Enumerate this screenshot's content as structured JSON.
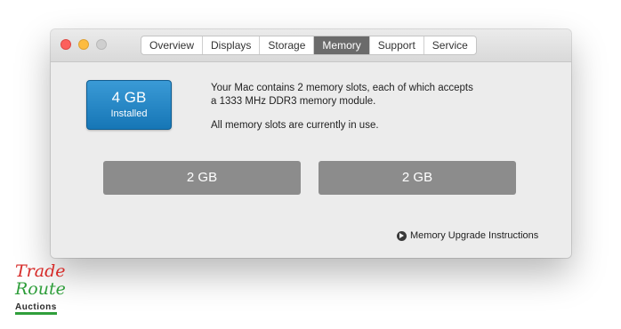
{
  "tabs": [
    {
      "label": "Overview"
    },
    {
      "label": "Displays"
    },
    {
      "label": "Storage"
    },
    {
      "label": "Memory",
      "active": true
    },
    {
      "label": "Support"
    },
    {
      "label": "Service"
    }
  ],
  "memory": {
    "amount": "4 GB",
    "status": "Installed",
    "description_line1": "Your Mac contains 2 memory slots, each of which accepts",
    "description_line2": "a 1333 MHz DDR3 memory module.",
    "slots_status": "All memory slots are currently in use.",
    "slots": [
      "2 GB",
      "2 GB"
    ],
    "upgrade_link": "Memory Upgrade Instructions"
  },
  "watermark": {
    "line1": "Trade",
    "line2": "Route",
    "line3": "Auctions"
  },
  "colors": {
    "badge": "#1f86c6",
    "slot": "#8c8c8c",
    "active_tab": "#6b6b6b"
  }
}
